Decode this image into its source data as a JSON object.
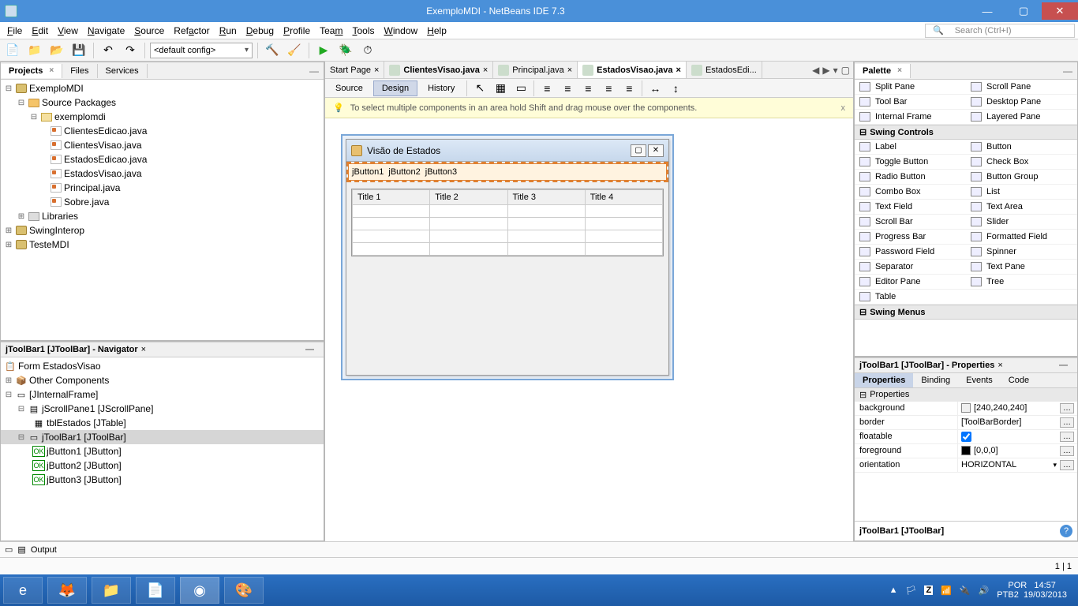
{
  "window": {
    "title": "ExemploMDI - NetBeans IDE 7.3"
  },
  "menu": [
    "File",
    "Edit",
    "View",
    "Navigate",
    "Source",
    "Refactor",
    "Run",
    "Debug",
    "Profile",
    "Team",
    "Tools",
    "Window",
    "Help"
  ],
  "search_placeholder": "Search (Ctrl+I)",
  "config_label": "<default config>",
  "left_tabs": [
    "Projects",
    "Files",
    "Services"
  ],
  "projects": {
    "root": "ExemploMDI",
    "src": "Source Packages",
    "pkg": "exemplomdi",
    "files": [
      "ClientesEdicao.java",
      "ClientesVisao.java",
      "EstadosEdicao.java",
      "EstadosVisao.java",
      "Principal.java",
      "Sobre.java"
    ],
    "libs": "Libraries",
    "other": [
      "SwingInterop",
      "TesteMDI"
    ]
  },
  "navigator": {
    "title": "jToolBar1 [JToolBar] - Navigator",
    "form": "Form EstadosVisao",
    "other_comp": "Other Components",
    "iframe": "[JInternalFrame]",
    "scroll": "jScrollPane1 [JScrollPane]",
    "table": "tblEstados [JTable]",
    "toolbar": "jToolBar1 [JToolBar]",
    "buttons": [
      "jButton1 [JButton]",
      "jButton2 [JButton]",
      "jButton3 [JButton]"
    ]
  },
  "editor_tabs": [
    {
      "label": "Start Page",
      "active": false,
      "form": false
    },
    {
      "label": "ClientesVisao.java",
      "active": false,
      "form": true
    },
    {
      "label": "Principal.java",
      "active": false,
      "form": true
    },
    {
      "label": "EstadosVisao.java",
      "active": true,
      "form": true
    },
    {
      "label": "EstadosEdi...",
      "active": false,
      "form": true
    }
  ],
  "subtabs": [
    "Source",
    "Design",
    "History"
  ],
  "hint": "To select multiple components in an area hold Shift and drag mouse over the components.",
  "designer": {
    "frame_title": "Visão de Estados",
    "toolbar_items": [
      "jButton1",
      "jButton2",
      "jButton3"
    ],
    "table_headers": [
      "Title 1",
      "Title 2",
      "Title 3",
      "Title 4"
    ]
  },
  "palette": {
    "title": "Palette",
    "containers": [
      [
        "Split Pane",
        "Scroll Pane"
      ],
      [
        "Tool Bar",
        "Desktop Pane"
      ],
      [
        "Internal Frame",
        "Layered Pane"
      ]
    ],
    "controls_title": "Swing Controls",
    "controls": [
      [
        "Label",
        "Button"
      ],
      [
        "Toggle Button",
        "Check Box"
      ],
      [
        "Radio Button",
        "Button Group"
      ],
      [
        "Combo Box",
        "List"
      ],
      [
        "Text Field",
        "Text Area"
      ],
      [
        "Scroll Bar",
        "Slider"
      ],
      [
        "Progress Bar",
        "Formatted Field"
      ],
      [
        "Password Field",
        "Spinner"
      ],
      [
        "Separator",
        "Text Pane"
      ],
      [
        "Editor Pane",
        "Tree"
      ],
      [
        "Table",
        ""
      ]
    ],
    "menus_title": "Swing Menus"
  },
  "properties": {
    "title": "jToolBar1 [JToolBar] - Properties",
    "tabs": [
      "Properties",
      "Binding",
      "Events",
      "Code"
    ],
    "section": "Properties",
    "rows": [
      {
        "k": "background",
        "v": "[240,240,240]",
        "swatch": "#f0f0f0",
        "dots": true
      },
      {
        "k": "border",
        "v": "[ToolBarBorder]",
        "dots": true
      },
      {
        "k": "floatable",
        "v": "",
        "check": true,
        "dots": true
      },
      {
        "k": "foreground",
        "v": "[0,0,0]",
        "swatch": "#000000",
        "dots": true
      },
      {
        "k": "orientation",
        "v": "HORIZONTAL",
        "combo": true,
        "dots": true
      }
    ],
    "footer": "jToolBar1 [JToolBar]"
  },
  "output_label": "Output",
  "status_pos": "1 | 1",
  "taskbar": {
    "lang": "POR",
    "kb": "PTB2",
    "time": "14:57",
    "date": "19/03/2013"
  }
}
